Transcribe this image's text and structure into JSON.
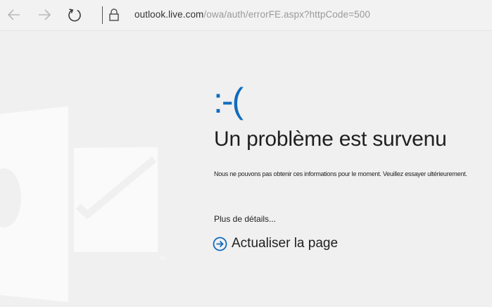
{
  "browser": {
    "url_host": "outlook.live.com",
    "url_path": "/owa/auth/errorFE.aspx?httpCode=500",
    "back_icon": "back-arrow-icon",
    "forward_icon": "forward-arrow-icon",
    "refresh_icon": "refresh-icon",
    "lock_icon": "lock-icon"
  },
  "error": {
    "face": ":-(",
    "title": "Un problème est survenu",
    "message": "Nous ne pouvons pas obtenir ces informations pour le moment. Veuillez essayer ultérieurement.",
    "details_link": "Plus de détails...",
    "refresh_label": "Actualiser la page"
  },
  "colors": {
    "accent": "#0f6cbd",
    "background": "#f0f0f0",
    "logo_watermark": "#ffffff"
  },
  "branding": {
    "logo_icon": "outlook-logo-icon"
  }
}
